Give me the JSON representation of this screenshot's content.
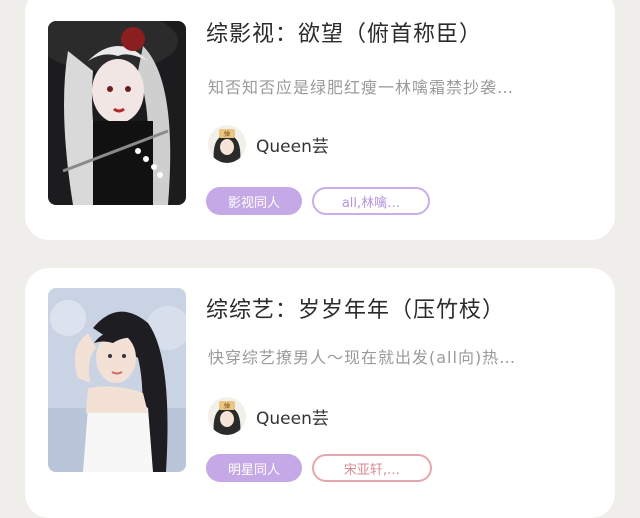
{
  "colors": {
    "page_bg": "#efeeea",
    "card_bg": "#ffffff",
    "tag_filled_bg": "#c5a8e6",
    "tag_outline_purple": "#caaeea",
    "tag_outline_pink": "#e4a7ae"
  },
  "cards": [
    {
      "title": "综影视：欲望（俯首称臣）",
      "description": "知否知否应是绿肥红瘦一林噙霜禁抄袭…",
      "author": "Queen芸",
      "avatar_text": "弹",
      "tags": [
        "影视同人",
        "all,林噙…"
      ]
    },
    {
      "title": "综综艺：岁岁年年（压竹枝）",
      "description": "快穿综艺撩男人～现在就出发(all向)热…",
      "author": "Queen芸",
      "avatar_text": "弹",
      "tags": [
        "明星同人",
        "宋亚轩,…"
      ]
    }
  ]
}
